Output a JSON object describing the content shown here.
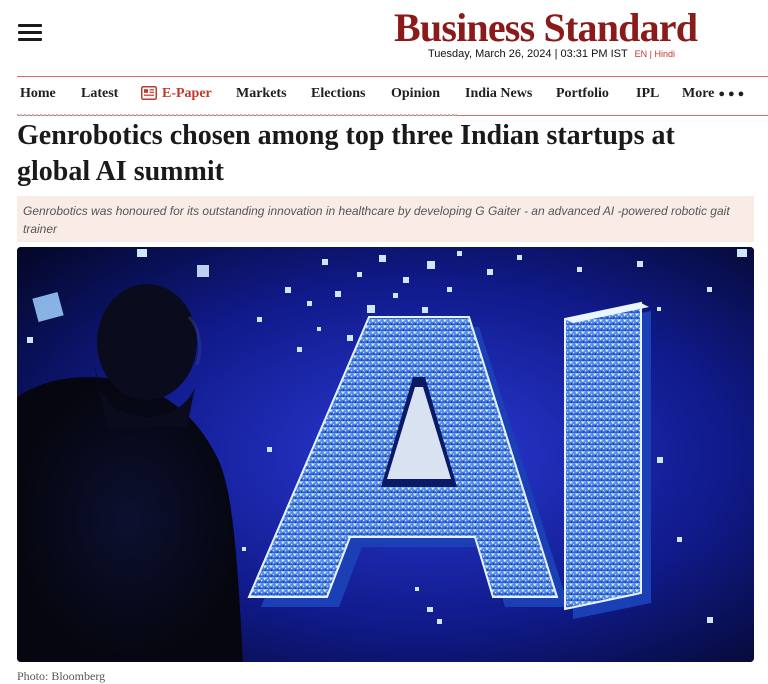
{
  "brand": {
    "name": "Business Standard",
    "color": "#8b1a1a"
  },
  "dateline": {
    "text": "Tuesday, March 26, 2024 | 03:31 PM IST",
    "lang_en": "EN",
    "lang_sep": "|",
    "lang_hindi": "Hindi"
  },
  "nav": {
    "items": [
      "Home",
      "Latest",
      "E-Paper",
      "Markets",
      "Elections",
      "Opinion",
      "India News",
      "Portfolio",
      "IPL",
      "More"
    ],
    "epaper_icon": "newspaper-icon",
    "more_icon": "dots-icon"
  },
  "article": {
    "headline": "Genrobotics chosen among top three Indian startups at global AI summit",
    "summary": "Genrobotics was honoured for its outstanding innovation in healthcare by developing G Gaiter - an advanced AI -powered robotic gait trainer",
    "image_caption": "Photo: Bloomberg"
  },
  "colors": {
    "accent": "#c0392b",
    "nav_border": "#d86a6a",
    "summary_bg": "#f9ece7",
    "hero_bg": "#050a3a"
  }
}
